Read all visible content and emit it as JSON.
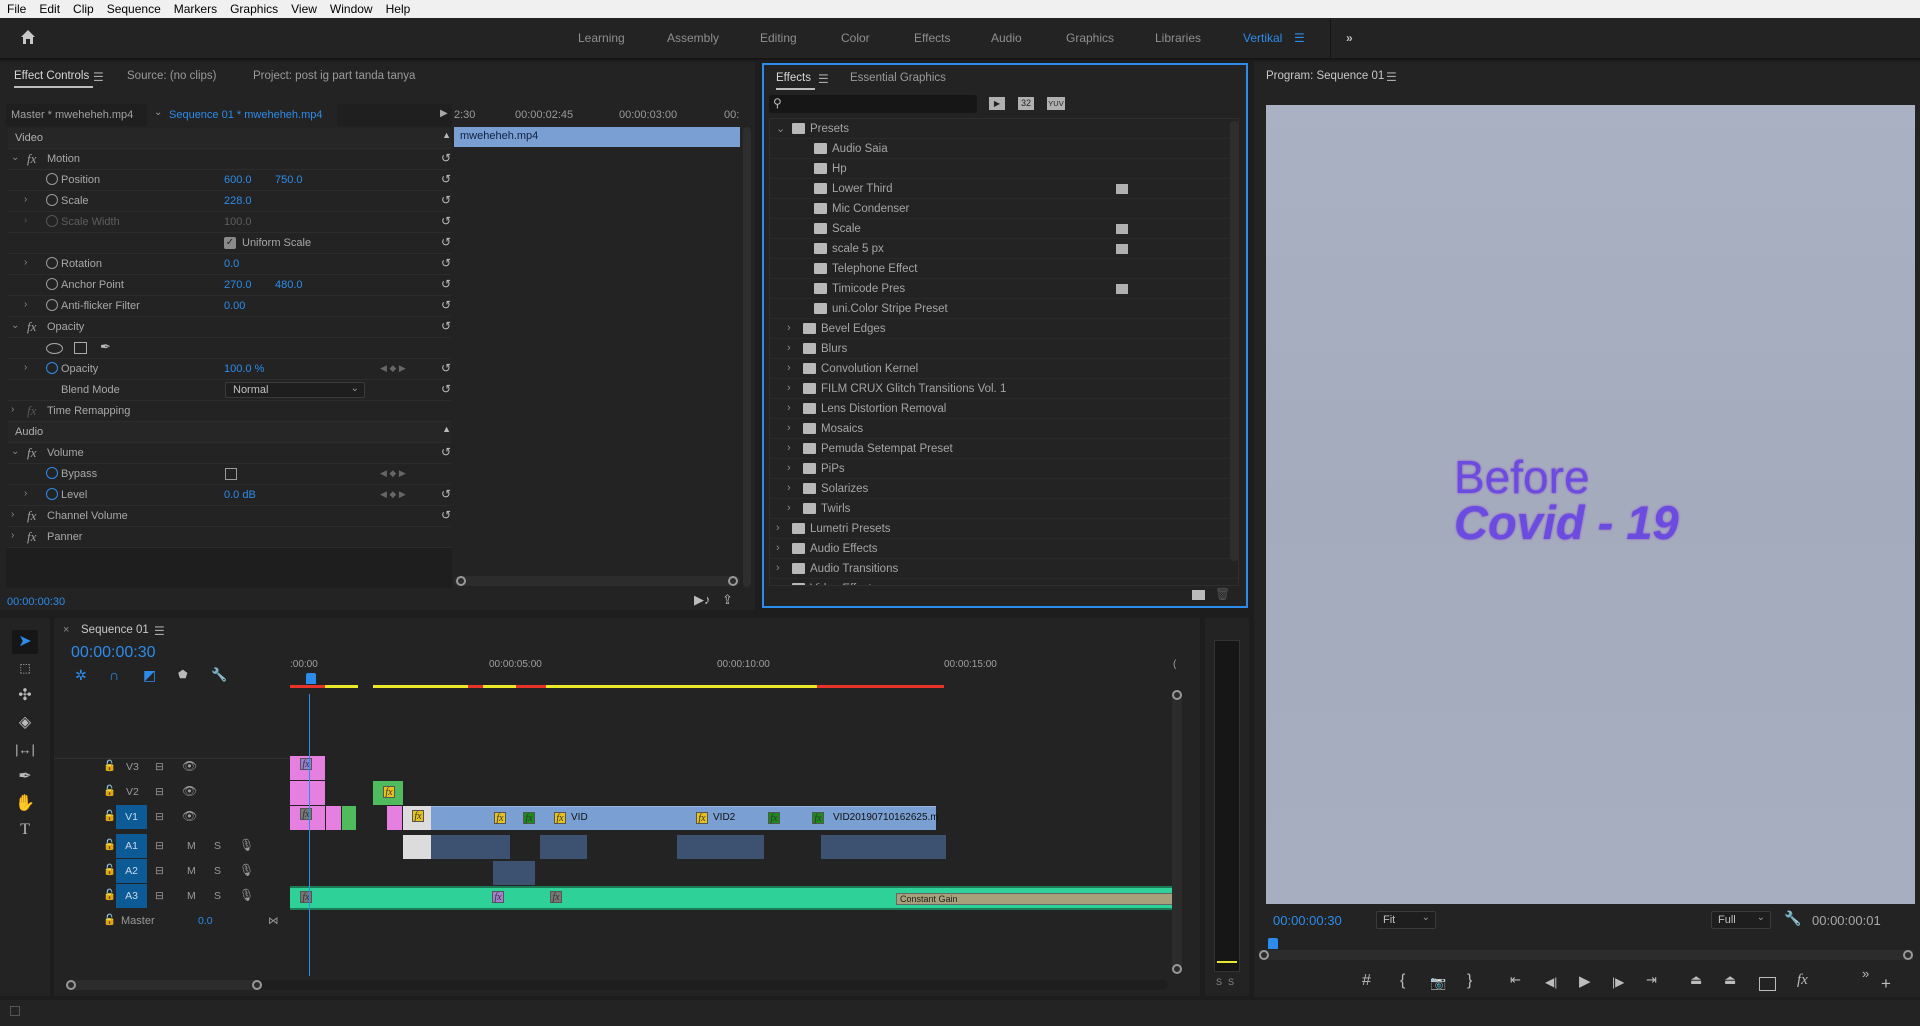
{
  "menu": [
    "File",
    "Edit",
    "Clip",
    "Sequence",
    "Markers",
    "Graphics",
    "View",
    "Window",
    "Help"
  ],
  "workspaces": [
    {
      "label": "Learning",
      "active": false
    },
    {
      "label": "Assembly",
      "active": false
    },
    {
      "label": "Editing",
      "active": false
    },
    {
      "label": "Color",
      "active": false
    },
    {
      "label": "Effects",
      "active": false
    },
    {
      "label": "Audio",
      "active": false
    },
    {
      "label": "Graphics",
      "active": false
    },
    {
      "label": "Libraries",
      "active": false
    },
    {
      "label": "Vertikal",
      "active": true
    }
  ],
  "colors": {
    "accent": "#2d8ceb",
    "panel": "#232323",
    "clip_video": "#7aa0d3",
    "clip_pink": "#e57fe0",
    "clip_green": "#4fbb5c",
    "clip_audio": "#2ed197",
    "ruler_red": "#e8332a",
    "ruler_yellow": "#e9e92a"
  },
  "effect_controls": {
    "tabs": [
      "Effect Controls",
      "Source: (no clips)",
      "Project: post ig part tanda tanya"
    ],
    "master_label": "Master * mweheheh.mp4",
    "sequence_label": "Sequence 01 * mweheheh.mp4",
    "mini_ruler": [
      "2:30",
      "00:00:02:45",
      "00:00:03:00",
      "00:"
    ],
    "clip_name": "mweheheh.mp4",
    "video_header": "Video",
    "audio_header": "Audio",
    "motion": "Motion",
    "position": {
      "label": "Position",
      "x": "600.0",
      "y": "750.0"
    },
    "scale": {
      "label": "Scale",
      "value": "228.0"
    },
    "scale_width": {
      "label": "Scale Width",
      "value": "100.0"
    },
    "uniform_scale": {
      "label": "Uniform Scale",
      "checked": true
    },
    "rotation": {
      "label": "Rotation",
      "value": "0.0"
    },
    "anchor": {
      "label": "Anchor Point",
      "x": "270.0",
      "y": "480.0"
    },
    "antiflicker": {
      "label": "Anti-flicker Filter",
      "value": "0.00"
    },
    "opacity_group": "Opacity",
    "opacity": {
      "label": "Opacity",
      "value": "100.0 %"
    },
    "blend": {
      "label": "Blend Mode",
      "value": "Normal"
    },
    "time_remap": "Time Remapping",
    "volume": "Volume",
    "bypass": {
      "label": "Bypass",
      "checked": false
    },
    "level": {
      "label": "Level",
      "value": "0.0 dB"
    },
    "channel_volume": "Channel Volume",
    "panner": "Panner",
    "timecode": "00:00:00:30"
  },
  "effects": {
    "tabs": [
      "Effects",
      "Essential Graphics"
    ],
    "search_placeholder": "",
    "toolbar": [
      "accelerated-effects-icon",
      "32-bit-icon",
      "yuv-icon"
    ],
    "toolbar_text": [
      "",
      "32",
      "YUV"
    ],
    "items": [
      {
        "label": "Presets",
        "level": 0,
        "expanded": true,
        "type": "preset-folder"
      },
      {
        "label": "Audio Saia",
        "level": 2,
        "type": "audio-preset"
      },
      {
        "label": "Hp",
        "level": 2,
        "type": "audio-preset"
      },
      {
        "label": "Lower Third",
        "level": 2,
        "type": "video-preset",
        "badge": true
      },
      {
        "label": "Mic Condenser",
        "level": 2,
        "type": "audio-preset"
      },
      {
        "label": "Scale",
        "level": 2,
        "type": "video-preset",
        "badge": true
      },
      {
        "label": "scale 5 px",
        "level": 2,
        "type": "video-preset",
        "badge": true
      },
      {
        "label": "Telephone Effect",
        "level": 2,
        "type": "audio-preset"
      },
      {
        "label": "Timicode Pres",
        "level": 2,
        "type": "video-preset",
        "badge": true
      },
      {
        "label": "uni.Color Stripe Preset",
        "level": 2,
        "type": "video-preset"
      },
      {
        "label": "Bevel Edges",
        "level": 1,
        "type": "preset-folder"
      },
      {
        "label": "Blurs",
        "level": 1,
        "type": "preset-folder"
      },
      {
        "label": "Convolution Kernel",
        "level": 1,
        "type": "preset-folder"
      },
      {
        "label": "FILM CRUX Glitch Transitions Vol. 1",
        "level": 1,
        "type": "preset-folder"
      },
      {
        "label": "Lens Distortion Removal",
        "level": 1,
        "type": "preset-folder"
      },
      {
        "label": "Mosaics",
        "level": 1,
        "type": "preset-folder"
      },
      {
        "label": "Pemuda Setempat Preset",
        "level": 1,
        "type": "preset-folder"
      },
      {
        "label": "PiPs",
        "level": 1,
        "type": "preset-folder"
      },
      {
        "label": "Solarizes",
        "level": 1,
        "type": "preset-folder"
      },
      {
        "label": "Twirls",
        "level": 1,
        "type": "preset-folder"
      },
      {
        "label": "Lumetri Presets",
        "level": 0,
        "type": "preset-folder"
      },
      {
        "label": "Audio Effects",
        "level": 0,
        "type": "folder"
      },
      {
        "label": "Audio Transitions",
        "level": 0,
        "type": "folder"
      },
      {
        "label": "Video Effects",
        "level": 0,
        "type": "folder"
      }
    ]
  },
  "program": {
    "title": "Program: Sequence 01",
    "overlay_line1": "Before",
    "overlay_line2": "Covid - 19",
    "timecode": "00:00:00:30",
    "zoom": "Fit",
    "resolution": "Full",
    "duration": "00:00:00:01"
  },
  "timeline": {
    "tab": "Sequence 01",
    "timecode": "00:00:00:30",
    "ruler": [
      ":00:00",
      "00:00:05:00",
      "00:00:10:00",
      "00:00:15:00",
      "("
    ],
    "video_tracks": [
      "V3",
      "V2",
      "V1"
    ],
    "audio_tracks": [
      "A1",
      "A2",
      "A3"
    ],
    "master": {
      "label": "Master",
      "value": "0.0"
    },
    "clip_labels": [
      "VID",
      "VID2",
      "VID20190710162625.m"
    ],
    "audio_label": "Constant Gain",
    "meter_labels": [
      "S",
      "S"
    ]
  }
}
